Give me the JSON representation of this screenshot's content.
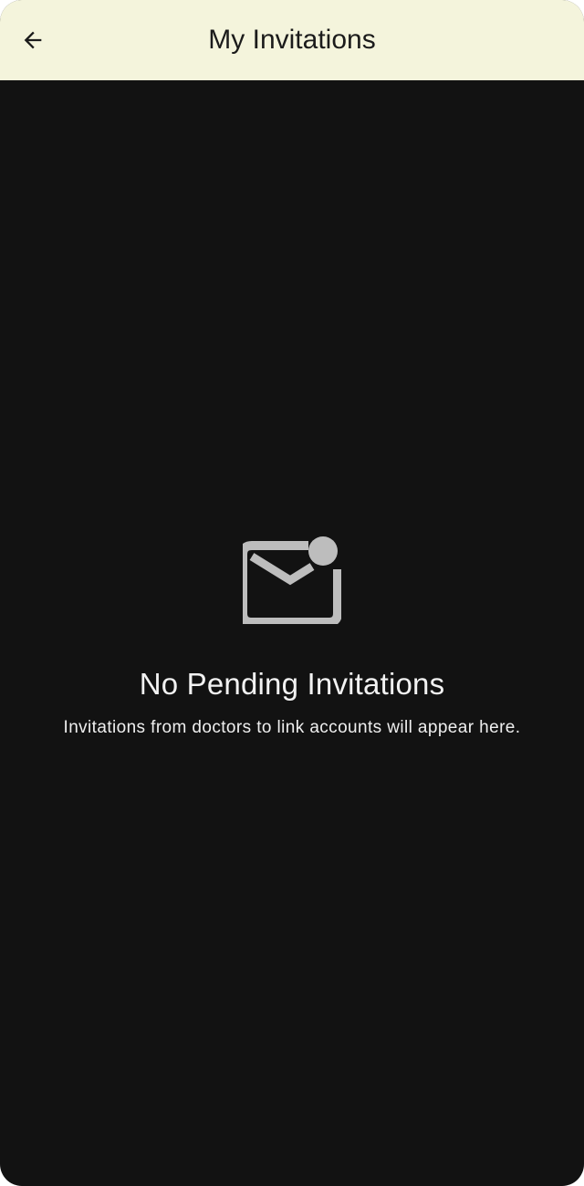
{
  "header": {
    "title": "My Invitations",
    "back_icon": "arrow-left-icon"
  },
  "empty_state": {
    "icon": "mail-unread-icon",
    "title": "No Pending Invitations",
    "message": "Invitations from doctors to link accounts will appear here."
  },
  "colors": {
    "app_bar_bg": "#f4f4dc",
    "screen_bg": "#121212",
    "icon_gray": "#bdbdbd",
    "text_light": "#f2f2f2"
  }
}
